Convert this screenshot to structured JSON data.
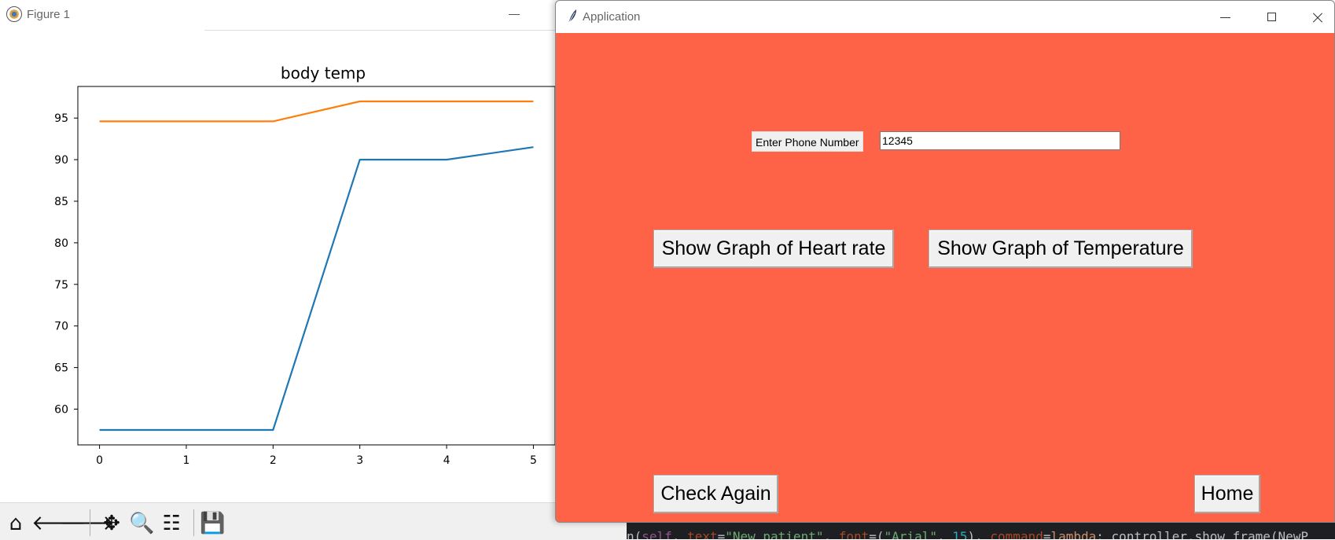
{
  "figure_window": {
    "title": "Figure 1",
    "toolbar": [
      {
        "name": "home-icon",
        "glyph": "⌂"
      },
      {
        "name": "back-arrow-icon",
        "glyph": "🡐"
      },
      {
        "name": "forward-arrow-icon",
        "glyph": "🡒"
      },
      {
        "name": "pan-icon",
        "glyph": "✥"
      },
      {
        "name": "zoom-icon",
        "glyph": "🔍"
      },
      {
        "name": "configure-subplots-icon",
        "glyph": "☷"
      },
      {
        "name": "save-icon",
        "glyph": "💾"
      }
    ]
  },
  "chart_data": {
    "type": "line",
    "title": "body temp",
    "xlabel": "",
    "ylabel": "",
    "x": [
      0,
      1,
      2,
      3,
      4,
      5
    ],
    "xticks": [
      "0",
      "1",
      "2",
      "3",
      "4",
      "5"
    ],
    "yticks": [
      "60",
      "65",
      "70",
      "75",
      "80",
      "85",
      "90",
      "95"
    ],
    "ylim": [
      55.7,
      98.8
    ],
    "xlim": [
      -0.25,
      5.25
    ],
    "grid": false,
    "series": [
      {
        "color": "#1f77b4",
        "values": [
          57.5,
          57.5,
          57.5,
          90,
          90,
          91.5
        ]
      },
      {
        "color": "#ff7f0e",
        "values": [
          94.6,
          94.6,
          94.6,
          97,
          97,
          97
        ]
      }
    ]
  },
  "app_window": {
    "title": "Application",
    "background": "#ff6347",
    "phone_label": "Enter Phone Number",
    "phone_value": "12345",
    "btn_heart": "Show Graph of Heart rate",
    "btn_temp": "Show Graph of Temperature",
    "btn_check": "Check Again",
    "btn_home": "Home"
  },
  "code_line": [
    {
      "text": "n(",
      "color": "#bcbec4"
    },
    {
      "text": "self",
      "color": "#94558d"
    },
    {
      "text": ", ",
      "color": "#bcbec4"
    },
    {
      "text": "text",
      "color": "#aa4926"
    },
    {
      "text": "=",
      "color": "#bcbec4"
    },
    {
      "text": "\"New patient\"",
      "color": "#6aab73"
    },
    {
      "text": ", ",
      "color": "#bcbec4"
    },
    {
      "text": "font",
      "color": "#aa4926"
    },
    {
      "text": "=(",
      "color": "#bcbec4"
    },
    {
      "text": "\"Arial\"",
      "color": "#6aab73"
    },
    {
      "text": ", ",
      "color": "#bcbec4"
    },
    {
      "text": "15",
      "color": "#2aacb8"
    },
    {
      "text": "), ",
      "color": "#bcbec4"
    },
    {
      "text": "command",
      "color": "#aa4926"
    },
    {
      "text": "=",
      "color": "#bcbec4"
    },
    {
      "text": "lambda",
      "color": "#cf8e6d"
    },
    {
      "text": ": controller.show_frame(NewP",
      "color": "#bcbec4"
    }
  ]
}
